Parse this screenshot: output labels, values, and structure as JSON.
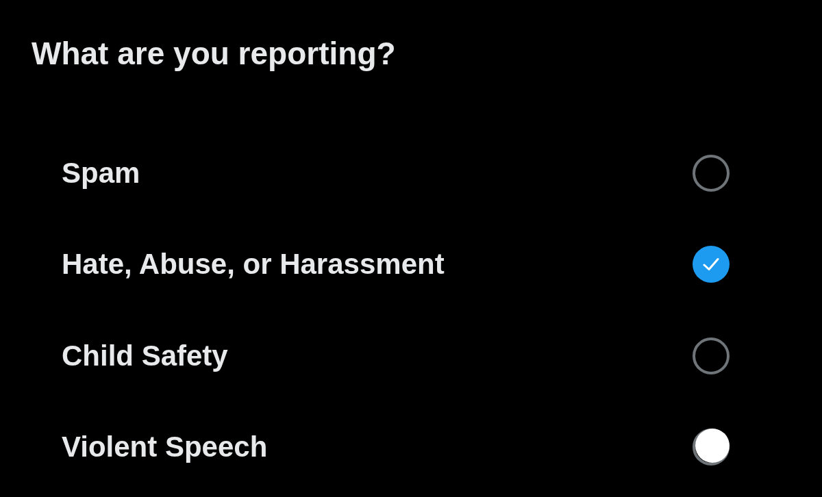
{
  "title": "What are you reporting?",
  "options": [
    {
      "label": "Spam",
      "selected": false,
      "pressed": false
    },
    {
      "label": "Hate, Abuse, or Harassment",
      "selected": true,
      "pressed": false
    },
    {
      "label": "Child Safety",
      "selected": false,
      "pressed": false
    },
    {
      "label": "Violent Speech",
      "selected": false,
      "pressed": true
    }
  ]
}
